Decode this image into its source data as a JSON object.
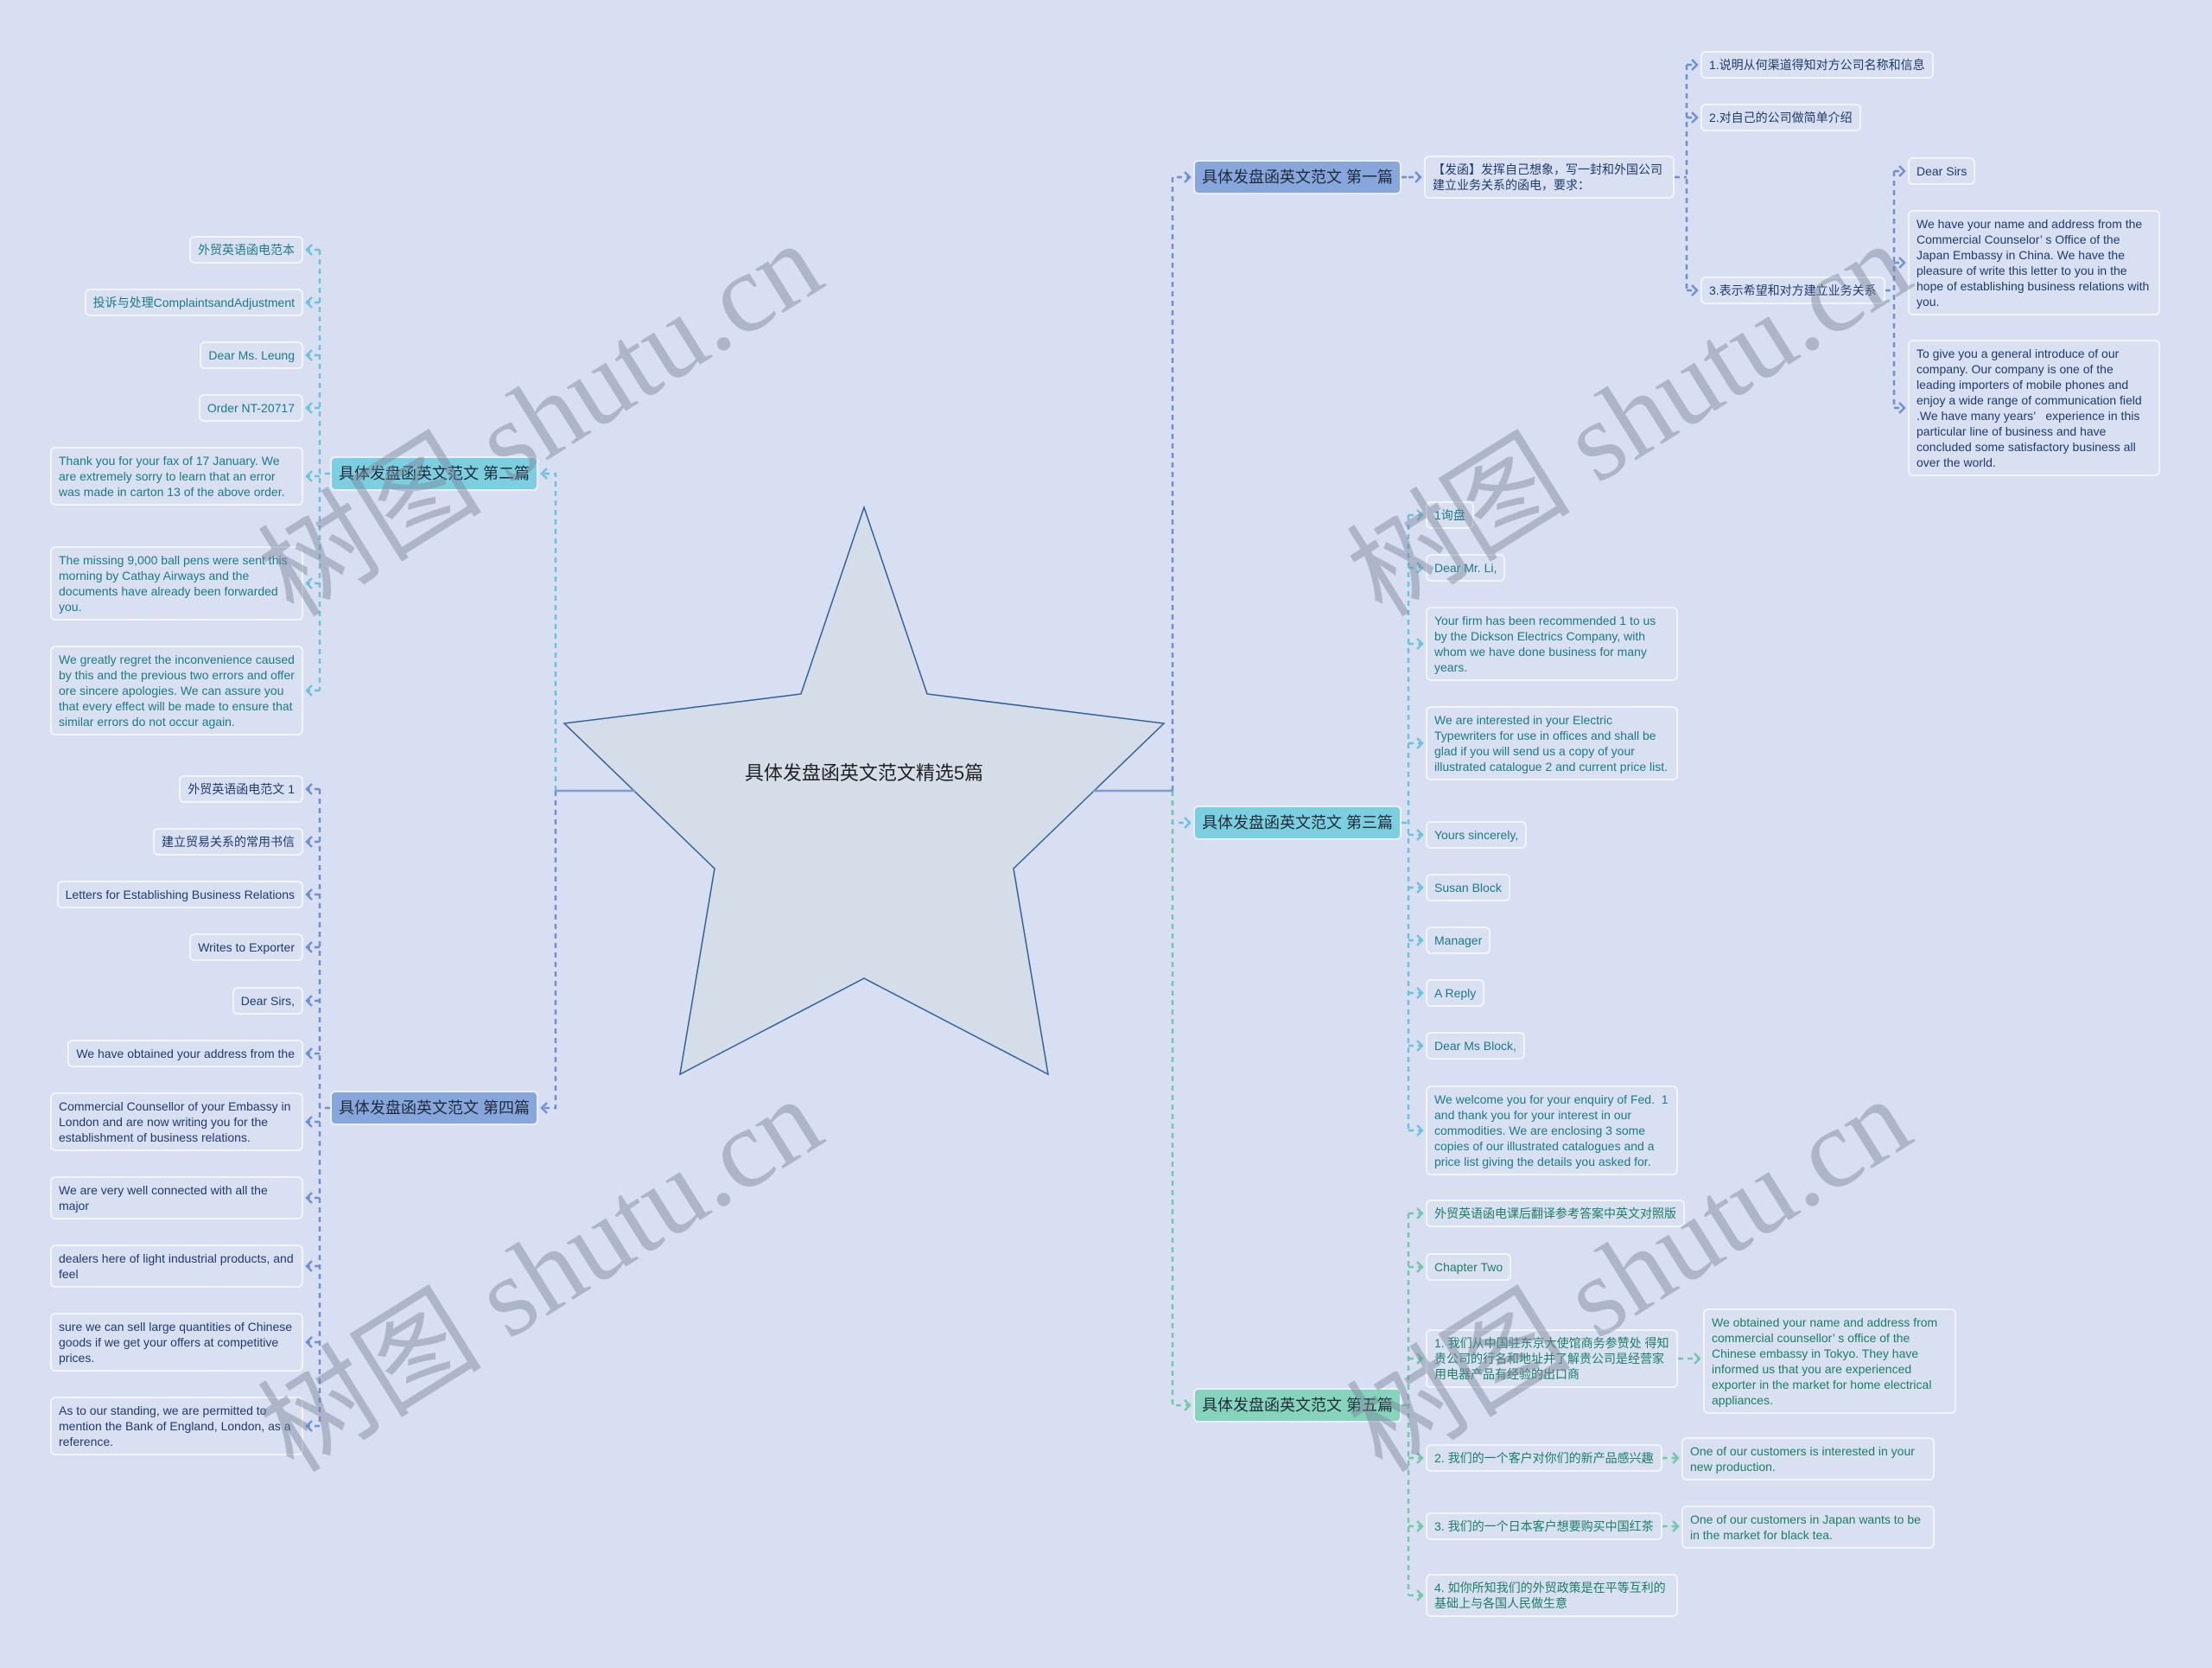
{
  "center": {
    "title": "具体发盘函英文范文精选5篇",
    "shape": "star"
  },
  "colors": {
    "background": "#d8dff2",
    "branch_blue": "#87a6dc",
    "branch_cyan": "#7ccfe0",
    "branch_green": "#86d4bc",
    "link_blue": "#6f8fd0",
    "link_cyan": "#6cc3d8",
    "link_green": "#6fcaa8",
    "star_fill": "#d5dde8",
    "star_stroke": "#2e5f9a"
  },
  "branches": {
    "b1": {
      "label": "具体发盘函英文范文 第一篇",
      "intro": "【发函】发挥自己想象，写一封和外国公司建立业务关系的函电，要求：",
      "points": [
        "1.说明从何渠道得知对方公司名称和信息",
        "2.对自己的公司做简单介绍",
        "3.表示希望和对方建立业务关系"
      ],
      "sub": [
        "Dear Sirs",
        "We have your name and address from the Commercial Counselor’ s Office of the Japan Embassy in China. We have the  pleasure of write this letter to you in the hope of establishing business relations with you.",
        "To give you a general introduce of our company. Our company is one of the leading importers of mobile phones and enjoy a wide range of communication field .We have many years’   experience in this particular line of business and have concluded some satisfactory business all over the world."
      ]
    },
    "b2": {
      "label": "具体发盘函英文范文 第二篇",
      "items": [
        "外贸英语函电范本",
        "投诉与处理ComplaintsandAdjustment",
        "Dear Ms. Leung",
        "Order NT-20717",
        "Thank you for your fax of 17 January. We are extremely sorry to learn that an error was made in carton 13 of the above order.",
        "The missing 9,000 ball pens were sent this morning by Cathay Airways and the documents have already been forwarded  you.",
        "We greatly regret the inconvenience caused by this and the previous two errors and offer ore sincere apologies. We can assure you that every effect will be made to ensure that similar errors do not occur again."
      ]
    },
    "b3": {
      "label": "具体发盘函英文范文 第三篇",
      "items": [
        "1询盘",
        "Dear Mr. Li,",
        "Your firm has been recommended 1 to us  by the Dickson Electrics Company, with whom we have done business for many years.",
        "We are interested in your Electric Typewriters for use in offices and shall be  glad if you will send us a copy of your illustrated catalogue 2 and current price list.",
        "Yours sincerely,",
        "Susan Block",
        "Manager",
        "A Reply",
        "Dear Ms Block,",
        "We welcome you for your enquiry of Fed.  1 and thank you for your interest in our commodities. We are enclosing 3 some copies of our illustrated catalogues and a  price list giving the details you asked for."
      ]
    },
    "b4": {
      "label": "具体发盘函英文范文 第四篇",
      "items": [
        "外贸英语函电范文 1",
        "建立贸易关系的常用书信",
        "Letters for Establishing Business Relations",
        "Writes to Exporter",
        "Dear Sirs,",
        "We have obtained your address from the",
        "Commercial Counsellor of your Embassy in London and are now writing you for the establishment of business relations.",
        "We are very well connected with all the major",
        "dealers here of light industrial products, and feel",
        "sure we can sell large quantities of Chinese goods if we get your offers at competitive prices.",
        "As to our standing, we are permitted to mention the Bank of England, London, as a reference."
      ]
    },
    "b5": {
      "label": "具体发盘函英文范文 第五篇",
      "items": [
        "外贸英语函电课后翻译参考答案中英文对照版",
        "Chapter Two",
        "1. 我们从中国驻东京大使馆商务参赞处 得知贵公司的行名和地址并了解贵公司是经营家用电器产品有经验的出口商",
        "2. 我们的一个客户对你们的新产品感兴趣",
        "3. 我们的一个日本客户想要购买中国红茶",
        "4. 如你所知我们的外贸政策是在平等互利的基础上与各国人民做生意"
      ],
      "translations": [
        "We obtained your name and address from commercial counsellor’ s office of the Chinese embassy in Tokyo. They have  informed us that you are experienced exporter in the market for home electrical  appliances.",
        "One of our customers is interested in your new production.",
        "One of our customers in Japan wants to be in the market for black tea."
      ]
    }
  },
  "watermark": {
    "text": "树图 shutu.cn"
  }
}
